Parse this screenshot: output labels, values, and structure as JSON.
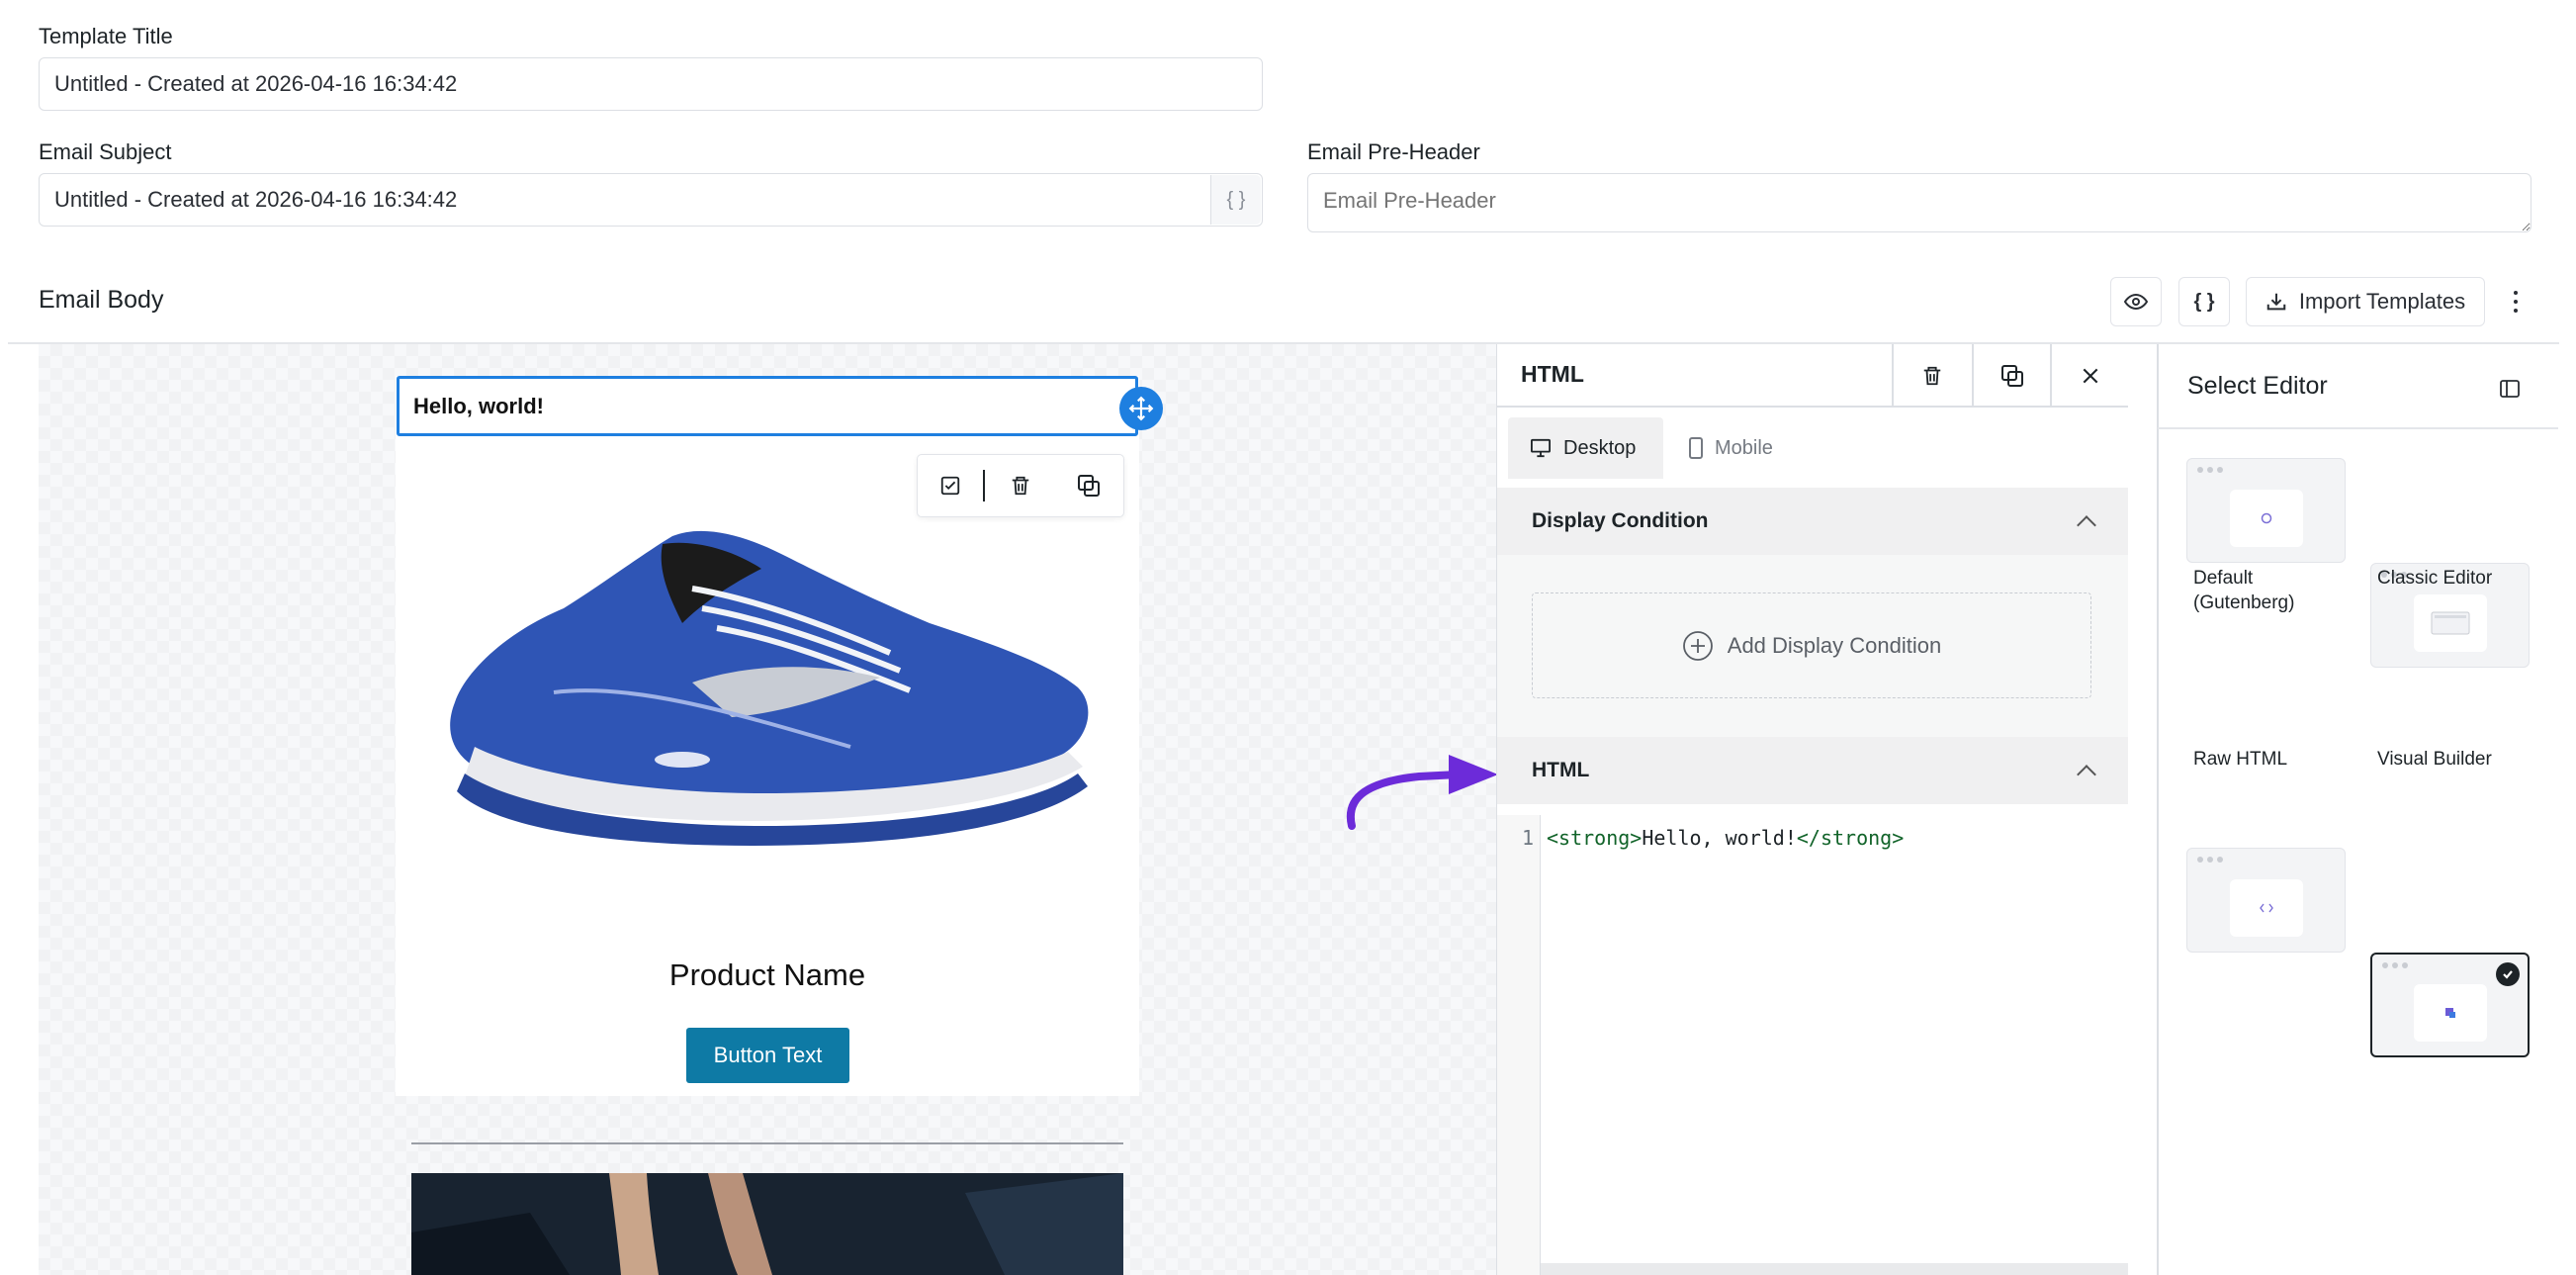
{
  "form": {
    "template_title_label": "Template Title",
    "template_title_value": "Untitled - Created at 2026-04-16 16:34:42",
    "email_subject_label": "Email Subject",
    "email_subject_value": "Untitled - Created at 2026-04-16 16:34:42",
    "subject_vars_icon": "{ }",
    "preheader_label": "Email Pre-Header",
    "preheader_placeholder": "Email Pre-Header"
  },
  "email_body": {
    "label": "Email Body",
    "code_button": "{ }",
    "import_button": "Import Templates"
  },
  "canvas": {
    "html_block_text": "Hello, world!",
    "product_name": "Product Name",
    "button_text": "Button Text"
  },
  "block_panel": {
    "title": "HTML",
    "tabs": [
      "Desktop",
      "Mobile"
    ],
    "display_condition_heading": "Display Condition",
    "add_condition_label": "Add Display Condition",
    "html_heading": "HTML",
    "line_number": "1",
    "code": {
      "open_tag": "<strong>",
      "content": "Hello, world!",
      "close_tag": "</strong>"
    }
  },
  "select_editor": {
    "title": "Select Editor",
    "options": [
      {
        "name": "Default (Gutenberg)",
        "selected": false
      },
      {
        "name": "Classic Editor",
        "selected": false
      },
      {
        "name": "Raw HTML",
        "selected": false
      },
      {
        "name": "Visual Builder",
        "selected": true
      }
    ]
  },
  "colors": {
    "accent_blue": "#1e7fe0",
    "button_teal": "#0e7aa5",
    "arrow_purple": "#6c2bd9"
  }
}
